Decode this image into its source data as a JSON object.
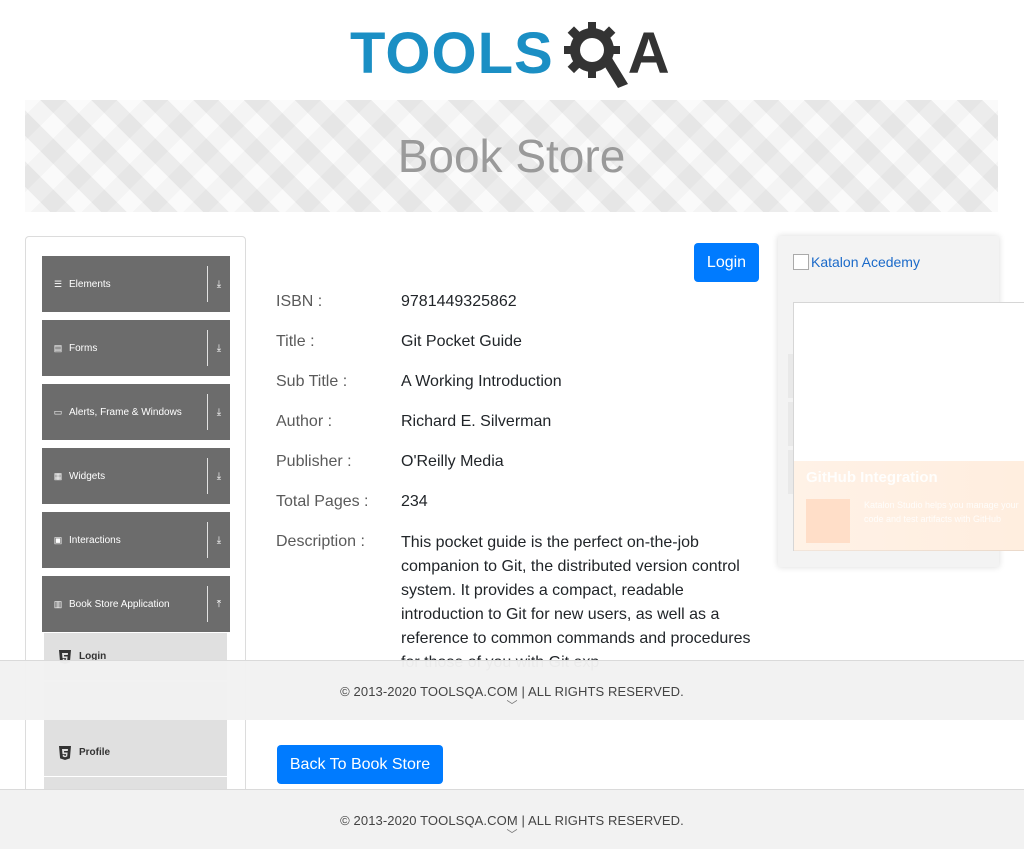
{
  "brand": {
    "logo_left": "TOOLS",
    "logo_right": "A",
    "logo_gear_letter": "Q"
  },
  "banner": {
    "title": "Book Store"
  },
  "sidebar": {
    "groups": [
      {
        "icon": "list-icon",
        "label": "Elements",
        "arrow": "download-arrow-icon"
      },
      {
        "icon": "form-icon",
        "label": "Forms",
        "arrow": "download-arrow-icon"
      },
      {
        "icon": "window-icon",
        "label": "Alerts, Frame & Windows",
        "arrow": "download-arrow-icon"
      },
      {
        "icon": "grid-icon",
        "label": "Widgets",
        "arrow": "download-arrow-icon"
      },
      {
        "icon": "cursor-icon",
        "label": "Interactions",
        "arrow": "download-arrow-icon"
      },
      {
        "icon": "library-icon",
        "label": "Book Store Application",
        "arrow": "upload-arrow-icon"
      }
    ],
    "subitems": [
      {
        "icon": "html5-icon",
        "label": "Login"
      },
      {
        "icon": "html5-icon",
        "label": "Profile"
      }
    ]
  },
  "main": {
    "login_label": "Login",
    "fields": [
      {
        "label": "ISBN :",
        "value": "9781449325862"
      },
      {
        "label": "Title :",
        "value": "Git Pocket Guide"
      },
      {
        "label": "Sub Title :",
        "value": "A Working Introduction"
      },
      {
        "label": "Author :",
        "value": "Richard E. Silverman"
      },
      {
        "label": "Publisher :",
        "value": "O'Reilly Media"
      },
      {
        "label": "Total Pages :",
        "value": "234"
      },
      {
        "label": "Description :",
        "value": "This pocket guide is the perfect on-the-job companion to Git, the distributed version control system. It provides a compact, readable introduction to Git for new users, as well as a reference to common commands and procedures for those of you with Git exp"
      }
    ],
    "back_label": "Back To Book Store"
  },
  "ad": {
    "alt_text": "Katalon Acedemy",
    "popup_title": "GitHub Integration",
    "popup_text": "Katalon Studio helps you manage your code and test artifacts with GitHub"
  },
  "footer": {
    "text": "© 2013-2020 TOOLSQA.COM | ALL RIGHTS RESERVED.",
    "chevron": "chevron-down-icon"
  },
  "colors": {
    "primary": "#007bff",
    "brand_blue": "#1b8fc4",
    "sidebar_group": "#6c6c6c"
  }
}
